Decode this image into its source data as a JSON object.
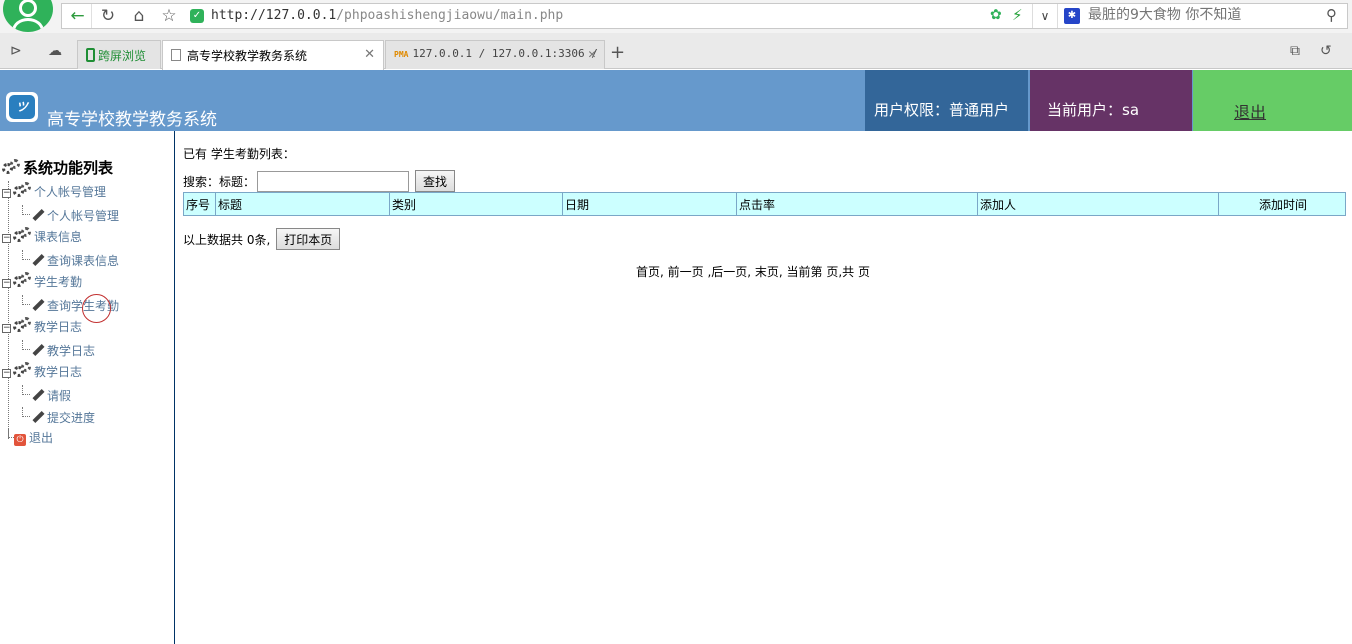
{
  "browser": {
    "url_host": "http://127.0.0.1",
    "url_path": "/phpoashishengjiaowu/main.php",
    "search_placeholder": "最脏的9大食物 你不知道",
    "tabs": [
      {
        "label": "跨屏浏览"
      },
      {
        "label": "高专学校教学教务系统"
      },
      {
        "label": "127.0.0.1 / 127.0.0.1:3306 / ",
        "icon_text": "PMA"
      }
    ]
  },
  "header": {
    "title": "高专学校教学教务系统",
    "permission": "用户权限：普通用户",
    "current_user": "当前用户：sa",
    "logout": "退出"
  },
  "sidebar": {
    "root": "系统功能列表",
    "groups": [
      {
        "label": "个人帐号管理",
        "items": [
          "个人帐号管理"
        ]
      },
      {
        "label": "课表信息",
        "items": [
          "查询课表信息"
        ]
      },
      {
        "label": "学生考勤",
        "items": [
          "查询学生考勤"
        ]
      },
      {
        "label": "教学日志",
        "items": [
          "教学日志"
        ]
      },
      {
        "label": "教学日志",
        "items": [
          "请假",
          "提交进度"
        ]
      }
    ],
    "exit": "退出"
  },
  "main": {
    "list_heading": "已有 学生考勤列表：",
    "search_label": "搜索：标题：",
    "search_button": "查找",
    "columns": [
      "序号",
      "标题",
      "类别",
      "日期",
      "点击率",
      "添加人",
      "添加时间"
    ],
    "summary": "以上数据共 0条,",
    "print_button": "打印本页",
    "pager": "首页, 前一页 ,后一页, 末页, 当前第 页,共 页"
  }
}
